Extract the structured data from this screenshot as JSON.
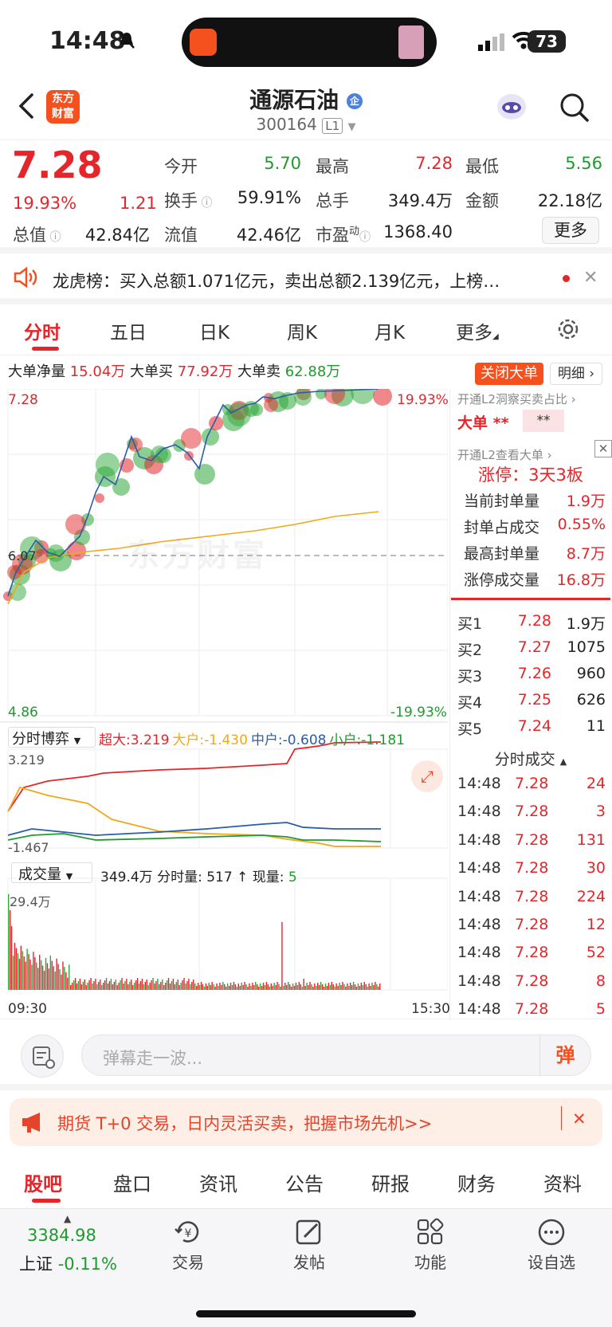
{
  "status": {
    "time": "14:48",
    "battery": "73"
  },
  "header": {
    "title": "通源石油",
    "badge": "企",
    "code": "300164",
    "level": "L1",
    "logo_line1": "东方",
    "logo_line2": "财富"
  },
  "quote": {
    "price": "7.28",
    "pct": "19.93%",
    "chg": "1.21",
    "open_label": "今开",
    "open": "5.70",
    "high_label": "最高",
    "high": "7.28",
    "low_label": "最低",
    "low": "5.56",
    "turnover_label": "换手",
    "turnover": "59.91%",
    "vol_label": "总手",
    "vol": "349.4万",
    "amt_label": "金额",
    "amt": "22.18亿",
    "mcap_label": "总值",
    "mcap": "42.84亿",
    "float_label": "流值",
    "float": "42.46亿",
    "pe_label": "市盈",
    "pe_sup": "动",
    "pe": "1368.40",
    "more": "更多"
  },
  "lhb": {
    "text": "龙虎榜：买入总额1.071亿元，卖出总额2.139亿元，上榜…"
  },
  "tabs": [
    "分时",
    "五日",
    "日K",
    "周K",
    "月K",
    "更多"
  ],
  "bigorder": {
    "net_label": "大单净量",
    "net": "15.04万",
    "buy_label": "大单买",
    "buy": "77.92万",
    "sell_label": "大单卖",
    "sell": "62.88万",
    "close_btn": "关闭大单",
    "detail_btn": "明细"
  },
  "chart": {
    "top_price": "7.28",
    "top_pct": "19.93%",
    "mid_price": "6.07",
    "bottom_price": "4.86",
    "bottom_pct": "-19.93%",
    "watermark": "东方财富",
    "game_label": "分时博弈",
    "game_items": [
      {
        "l": "超大:",
        "v": "3.219",
        "c": "#e4262b"
      },
      {
        "l": "大户:",
        "v": "-1.430",
        "c": "#f0a81c"
      },
      {
        "l": "中户:",
        "v": "-0.608",
        "c": "#2a5caa"
      },
      {
        "l": "小户:",
        "v": "-1.181",
        "c": "#1f9a2e"
      }
    ],
    "game_top": "3.219",
    "game_bottom": "-1.467",
    "vol_label": "成交量",
    "vol_info": "349.4万 分时量: 517 ↑ 现量:",
    "vol_now": "5",
    "vol_max": "29.4万",
    "t_start": "09:30",
    "t_end": "15:30"
  },
  "right_panel": {
    "l2_line": "开通L2洞察买卖占比 ›",
    "big_label": "大单",
    "big_stars1": "**",
    "big_stars2": "**",
    "l2_line2": "开通L2查看大单 ›",
    "limit_title": "涨停：3天3板",
    "limit_rows": [
      {
        "k": "当前封单量",
        "v": "1.9万"
      },
      {
        "k": "封单占成交",
        "v": "0.55%"
      },
      {
        "k": "最高封单量",
        "v": "8.7万"
      },
      {
        "k": "涨停成交量",
        "v": "16.8万"
      }
    ],
    "bids": [
      {
        "k": "买1",
        "p": "7.28",
        "v": "1.9万"
      },
      {
        "k": "买2",
        "p": "7.27",
        "v": "1075"
      },
      {
        "k": "买3",
        "p": "7.26",
        "v": "960"
      },
      {
        "k": "买4",
        "p": "7.25",
        "v": "626"
      },
      {
        "k": "买5",
        "p": "7.24",
        "v": "11"
      }
    ],
    "ticks_title": "分时成交",
    "ticks": [
      {
        "t": "14:48",
        "p": "7.28",
        "v": "24"
      },
      {
        "t": "14:48",
        "p": "7.28",
        "v": "3"
      },
      {
        "t": "14:48",
        "p": "7.28",
        "v": "131"
      },
      {
        "t": "14:48",
        "p": "7.28",
        "v": "30"
      },
      {
        "t": "14:48",
        "p": "7.28",
        "v": "224"
      },
      {
        "t": "14:48",
        "p": "7.28",
        "v": "12"
      },
      {
        "t": "14:48",
        "p": "7.28",
        "v": "52"
      },
      {
        "t": "14:48",
        "p": "7.28",
        "v": "8"
      },
      {
        "t": "14:48",
        "p": "7.28",
        "v": "5"
      }
    ]
  },
  "comment": {
    "placeholder": "弹幕走一波...",
    "btn": "弹"
  },
  "banner": {
    "text": "期货 T+0 交易，日内灵活买卖，把握市场先机>>"
  },
  "bottom_tabs": [
    "股吧",
    "盘口",
    "资讯",
    "公告",
    "研报",
    "财务",
    "资料"
  ],
  "nav": {
    "index_value": "3384.98",
    "index_name": "上证",
    "index_chg": "-0.11%",
    "items": [
      "交易",
      "发帖",
      "功能",
      "设自选"
    ]
  }
}
